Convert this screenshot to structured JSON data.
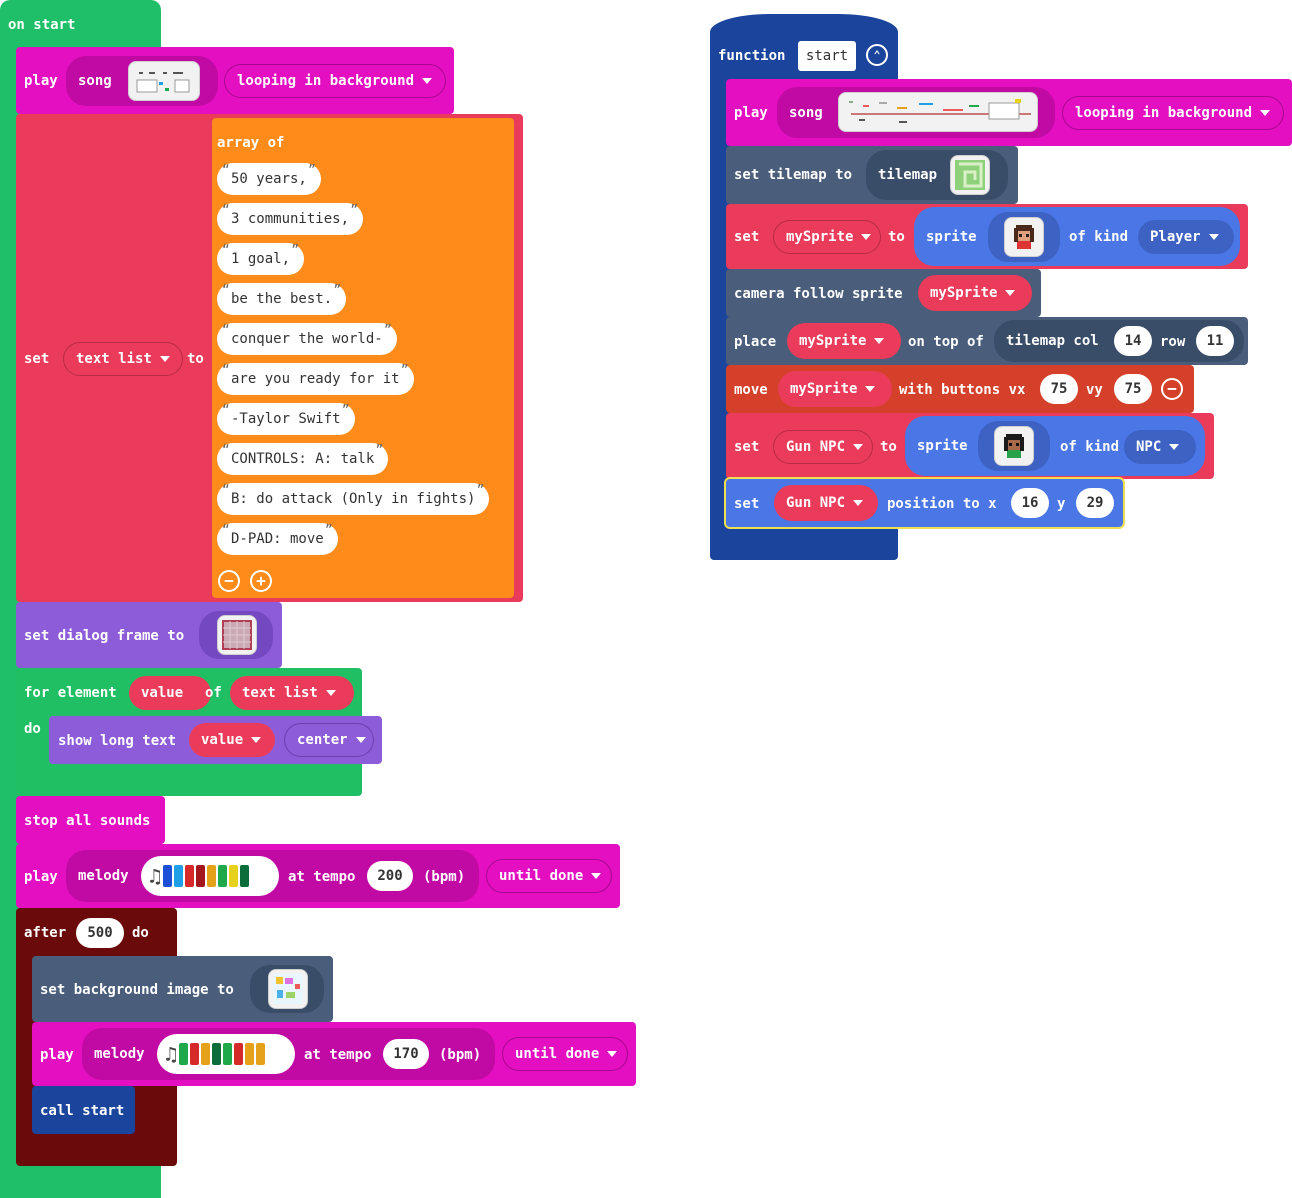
{
  "colors": {
    "event_green": "#1fbf69",
    "music_magenta": "#e30fc0",
    "variables_red": "#ea3c5a",
    "array_orange": "#ff8c1a",
    "game_purple": "#8d5cd8",
    "loops_green": "#20bf64",
    "scene_slate": "#4a5d7a",
    "sprites_blue": "#4a76e6",
    "controller_red": "#d5402b",
    "function_blue": "#1b459c",
    "timer_maroon": "#6a0a0a"
  },
  "on_start": {
    "hat_label": "on start",
    "play_song": {
      "play": "play",
      "song": "song",
      "mode": "looping in background"
    },
    "set_list": {
      "set": "set",
      "var": "text list",
      "to": "to",
      "array_of": "array of",
      "items": [
        "50 years,",
        "3 communities,",
        "1 goal,",
        "be the best.",
        "conquer the world-",
        "are you ready for it",
        "-Taylor Swift",
        "CONTROLS: A: talk",
        "B: do attack (Only in fights)",
        "D-PAD: move"
      ],
      "minus_icon": "minus-circle-icon",
      "plus_icon": "plus-circle-icon"
    },
    "dialog_frame": {
      "label": "set dialog frame to"
    },
    "for_element": {
      "for_element": "for element",
      "value": "value",
      "of": "of",
      "list": "text list",
      "do": "do",
      "show_long_text": "show long text",
      "text_var": "value",
      "align": "center"
    },
    "stop_sounds": "stop all sounds",
    "melody1": {
      "play": "play",
      "melody": "melody",
      "at_tempo": "at tempo",
      "tempo": "200",
      "bpm": "(bpm)",
      "mode": "until done",
      "note_colors": [
        "#1e4fd8",
        "#1fa0e6",
        "#d62a2a",
        "#a3181f",
        "#e6a11a",
        "#1fa94a",
        "#e6d21a",
        "#0d6d3a"
      ]
    },
    "after": {
      "after": "after",
      "ms": "500",
      "do": "do",
      "set_bg": "set background image to",
      "melody": {
        "play": "play",
        "melody": "melody",
        "at_tempo": "at tempo",
        "tempo": "170",
        "bpm": "(bpm)",
        "mode": "until done",
        "note_colors": [
          "#1fa94a",
          "#d62a2a",
          "#e6a11a",
          "#0d6d3a",
          "#1fa94a",
          "#d62a2a",
          "#e6a11a",
          "#e6a11a"
        ]
      },
      "call_start": "call start"
    }
  },
  "function_start": {
    "function": "function",
    "name": "start",
    "collapse_icon": "chevron-up-circle-icon",
    "play_song": {
      "play": "play",
      "song": "song",
      "mode": "looping in background"
    },
    "tilemap": {
      "label": "set tilemap to",
      "value": "tilemap"
    },
    "set_sprite": {
      "set": "set",
      "var": "mySprite",
      "to": "to",
      "sprite": "sprite",
      "of_kind": "of kind",
      "kind": "Player"
    },
    "camera": {
      "label": "camera follow sprite",
      "var": "mySprite"
    },
    "place": {
      "place": "place",
      "var": "mySprite",
      "on_top_of": "on top of",
      "tilemap_col": "tilemap col",
      "col": "14",
      "row_label": "row",
      "row": "11"
    },
    "move": {
      "move": "move",
      "var": "mySprite",
      "with_buttons": "with buttons vx",
      "vx": "75",
      "vy_label": "vy",
      "vy": "75",
      "icon": "minus-circle-icon"
    },
    "set_npc": {
      "set": "set",
      "var": "Gun NPC",
      "to": "to",
      "sprite": "sprite",
      "of_kind": "of kind",
      "kind": "NPC"
    },
    "set_pos": {
      "set": "set",
      "var": "Gun NPC",
      "position_to_x": "position to x",
      "x": "16",
      "y_label": "y",
      "y": "29"
    }
  }
}
